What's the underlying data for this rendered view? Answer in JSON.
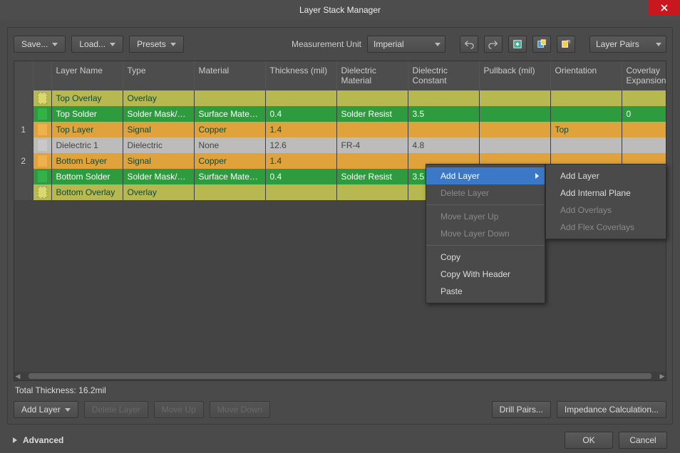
{
  "window": {
    "title": "Layer Stack Manager"
  },
  "toolbar": {
    "save": "Save...",
    "load": "Load...",
    "presets": "Presets",
    "measurement_label": "Measurement Unit",
    "unit_selected": "Imperial",
    "layer_mode": "Layer Pairs"
  },
  "columns": {
    "layer_name": "Layer Name",
    "type": "Type",
    "material": "Material",
    "thickness": "Thickness (mil)",
    "dielectric_material": "Dielectric Material",
    "dielectric_constant": "Dielectric Constant",
    "pullback": "Pullback (mil)",
    "orientation": "Orientation",
    "coverlay": "Coverlay Expansion"
  },
  "rows": [
    {
      "cls": "olive",
      "idx": "",
      "name": "Top Overlay",
      "type": "Overlay",
      "material": "",
      "th": "",
      "dm": "",
      "dc": "",
      "pb": "",
      "or": "",
      "ce": ""
    },
    {
      "cls": "green",
      "idx": "",
      "name": "Top Solder",
      "type": "Solder Mask/Co...",
      "material": "Surface Material",
      "th": "0.4",
      "dm": "Solder Resist",
      "dc": "3.5",
      "pb": "",
      "or": "",
      "ce": "0"
    },
    {
      "cls": "orange",
      "idx": "1",
      "name": "Top Layer",
      "type": "Signal",
      "material": "Copper",
      "th": "1.4",
      "dm": "",
      "dc": "",
      "pb": "",
      "or": "Top",
      "ce": ""
    },
    {
      "cls": "gray",
      "idx": "",
      "name": "Dielectric 1",
      "type": "Dielectric",
      "material": "None",
      "th": "12.6",
      "dm": "FR-4",
      "dc": "4.8",
      "pb": "",
      "or": "",
      "ce": ""
    },
    {
      "cls": "orange",
      "idx": "2",
      "name": "Bottom Layer",
      "type": "Signal",
      "material": "Copper",
      "th": "1.4",
      "dm": "",
      "dc": "",
      "pb": "",
      "or": "",
      "ce": ""
    },
    {
      "cls": "green",
      "idx": "",
      "name": "Bottom Solder",
      "type": "Solder Mask/Co...",
      "material": "Surface Material",
      "th": "0.4",
      "dm": "Solder Resist",
      "dc": "3.5",
      "pb": "",
      "or": "",
      "ce": ""
    },
    {
      "cls": "olive",
      "idx": "",
      "name": "Bottom Overlay",
      "type": "Overlay",
      "material": "",
      "th": "",
      "dm": "",
      "dc": "",
      "pb": "",
      "or": "",
      "ce": ""
    }
  ],
  "status": {
    "total_thickness": "Total Thickness: 16.2mil"
  },
  "buttons": {
    "add_layer": "Add Layer",
    "delete_layer": "Delete Layer",
    "move_up": "Move Up",
    "move_down": "Move Down",
    "drill_pairs": "Drill Pairs...",
    "impedance": "Impedance Calculation...",
    "advanced": "Advanced",
    "ok": "OK",
    "cancel": "Cancel"
  },
  "context1": {
    "add_layer": "Add Layer",
    "delete_layer": "Delete Layer",
    "move_up": "Move Layer Up",
    "move_down": "Move Layer Down",
    "copy": "Copy",
    "copy_header": "Copy With Header",
    "paste": "Paste"
  },
  "context2": {
    "add_layer": "Add Layer",
    "add_plane": "Add Internal Plane",
    "add_overlays": "Add Overlays",
    "add_flex": "Add Flex Coverlays"
  }
}
